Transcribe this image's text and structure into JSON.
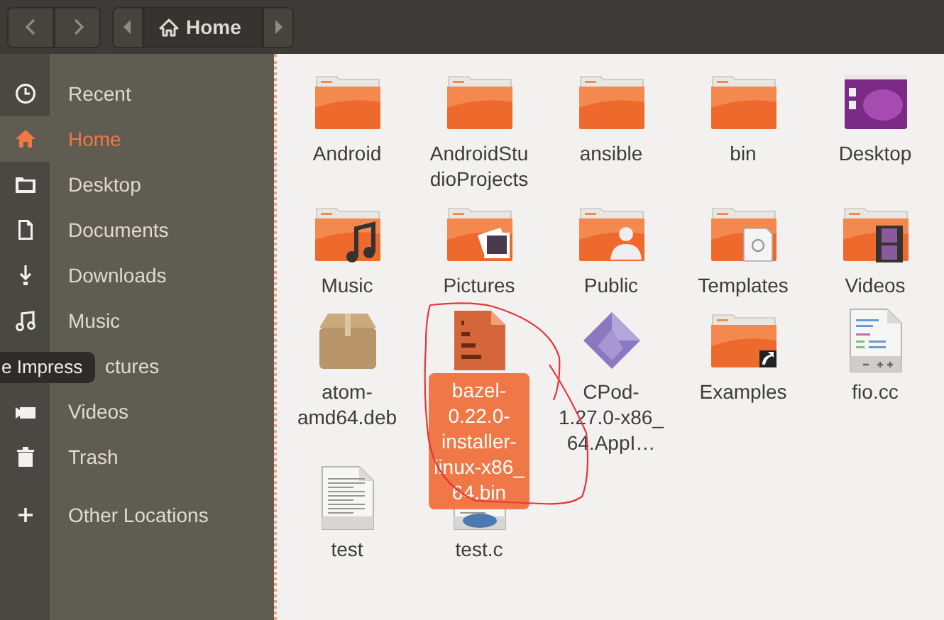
{
  "header": {
    "path": [
      {
        "label": "Home",
        "selected": true
      }
    ]
  },
  "sidebar": {
    "items": [
      {
        "label": "Recent",
        "kind": "recent",
        "selected": false
      },
      {
        "label": "Home",
        "kind": "home",
        "selected": true
      },
      {
        "label": "Desktop",
        "kind": "desktop",
        "selected": false
      },
      {
        "label": "Documents",
        "kind": "documents",
        "selected": false
      },
      {
        "label": "Downloads",
        "kind": "downloads",
        "selected": false
      },
      {
        "label": "Music",
        "kind": "music",
        "selected": false
      },
      {
        "label": "ctures",
        "kind": "pictures",
        "selected": false,
        "covered": true
      },
      {
        "label": "Videos",
        "kind": "videos",
        "selected": false
      },
      {
        "label": "Trash",
        "kind": "trash",
        "selected": false
      },
      {
        "label": "Other Locations",
        "kind": "other",
        "selected": false
      }
    ]
  },
  "tooltip": "e Impress",
  "files": [
    {
      "lines": [
        "Android"
      ],
      "kind": "folder",
      "selected": false
    },
    {
      "lines": [
        "AndroidStu",
        "dioProjects"
      ],
      "kind": "folder",
      "selected": false
    },
    {
      "lines": [
        "ansible"
      ],
      "kind": "folder",
      "selected": false
    },
    {
      "lines": [
        "bin"
      ],
      "kind": "folder",
      "selected": false
    },
    {
      "lines": [
        "Desktop"
      ],
      "kind": "desktop",
      "selected": false
    },
    {
      "lines": [
        "Music"
      ],
      "kind": "music",
      "selected": false
    },
    {
      "lines": [
        "Pictures"
      ],
      "kind": "pictures",
      "selected": false
    },
    {
      "lines": [
        "Public"
      ],
      "kind": "public",
      "selected": false
    },
    {
      "lines": [
        "Templates"
      ],
      "kind": "templates",
      "selected": false
    },
    {
      "lines": [
        "Videos"
      ],
      "kind": "videos",
      "selected": false
    },
    {
      "lines": [
        "atom-",
        "amd64.deb"
      ],
      "kind": "package",
      "selected": false
    },
    {
      "lines": [
        "bazel-",
        "0.22.0-",
        "installer-",
        "linux-x86_",
        "64.bin"
      ],
      "kind": "binary",
      "selected": true
    },
    {
      "lines": [
        "CPod-",
        "1.27.0-x86_",
        "64.AppI…"
      ],
      "kind": "appimage",
      "selected": false
    },
    {
      "lines": [
        "Examples"
      ],
      "kind": "link",
      "selected": false
    },
    {
      "lines": [
        "fio.cc"
      ],
      "kind": "cpp",
      "selected": false
    },
    {
      "lines": [
        "test"
      ],
      "kind": "text",
      "selected": false
    },
    {
      "lines": [
        "test.c"
      ],
      "kind": "csource",
      "selected": false
    }
  ]
}
